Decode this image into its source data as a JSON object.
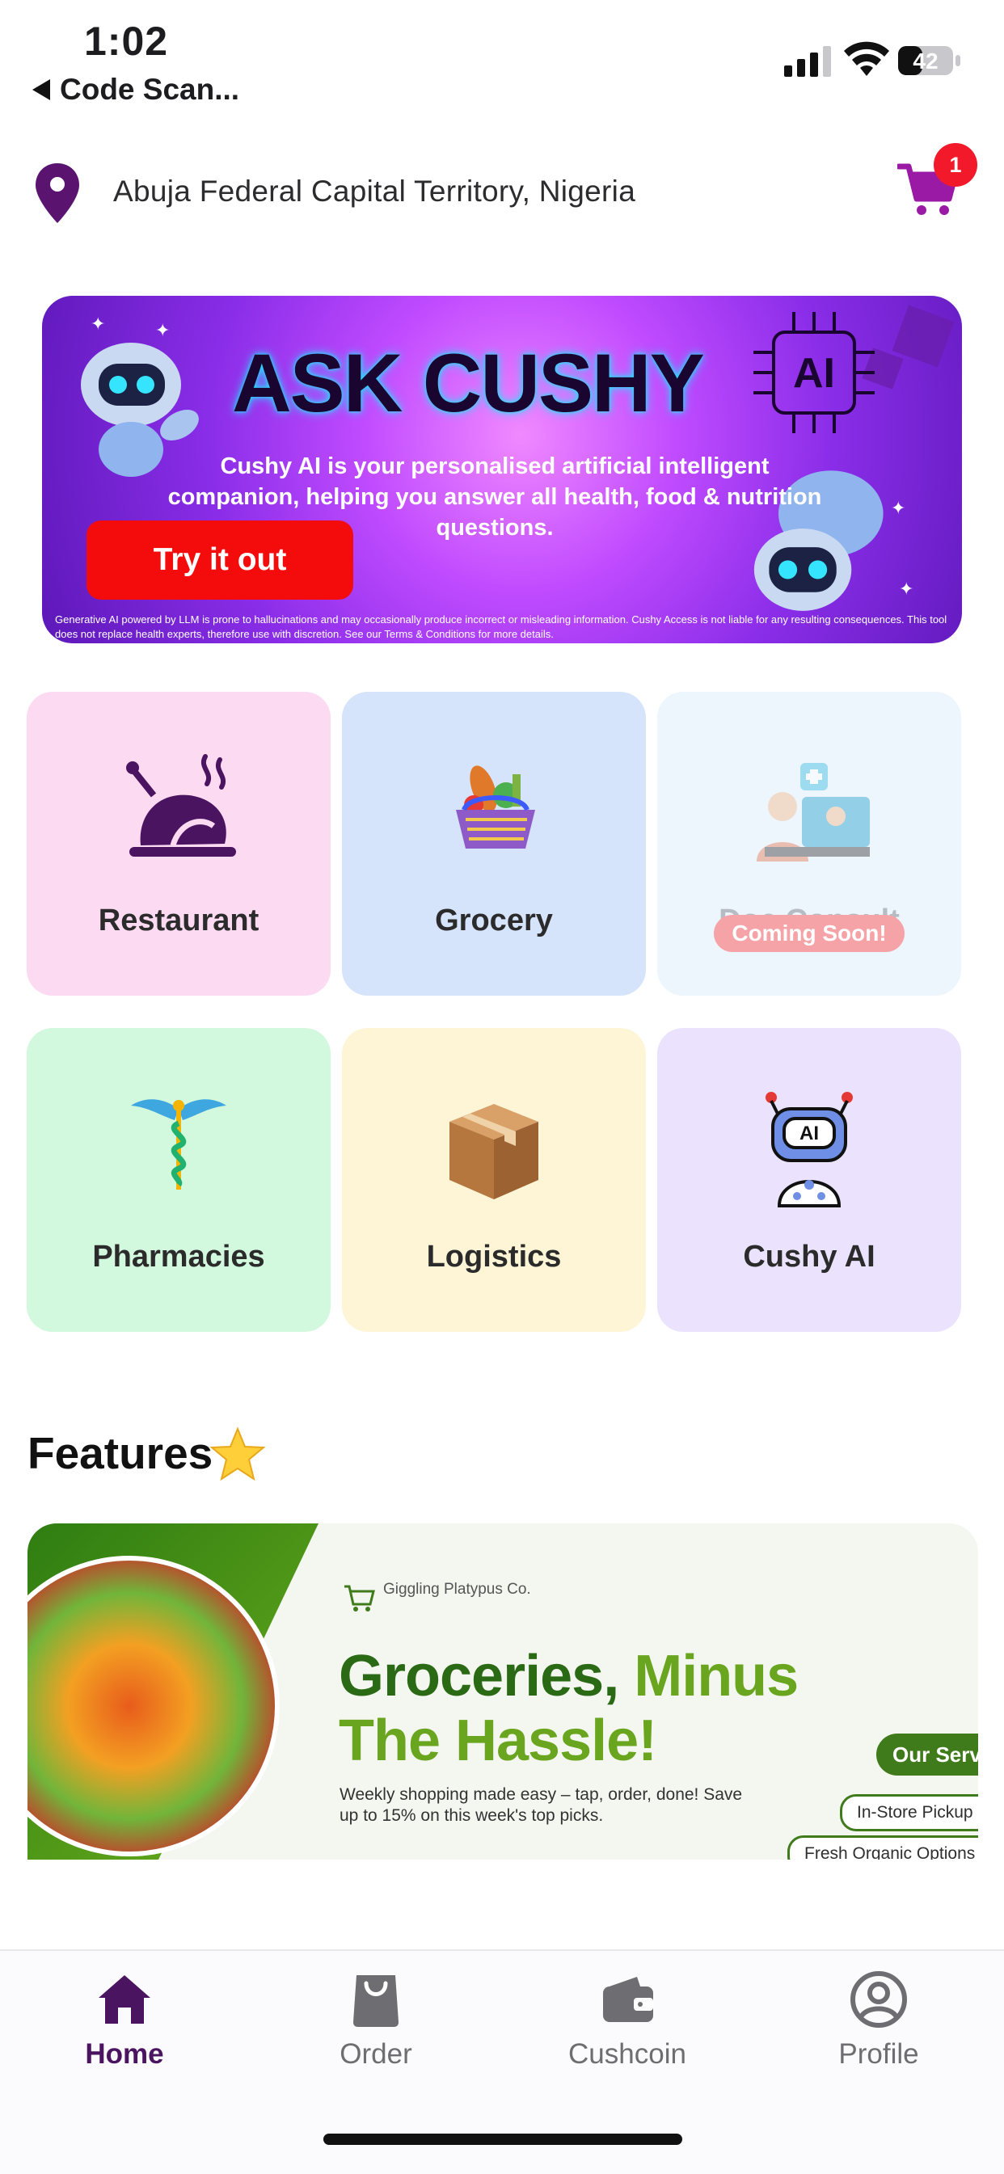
{
  "status_bar": {
    "time": "1:02",
    "back_label": "Code Scan...",
    "battery": "42"
  },
  "header": {
    "location": "Abuja Federal Capital Territory, Nigeria",
    "cart_count": "1"
  },
  "banner": {
    "title": "ASK CUSHY",
    "chip_label": "AI",
    "body": "Cushy AI is your personalised artificial intelligent companion, helping you answer all health, food & nutrition questions.",
    "cta": "Try it out",
    "disclaimer": "Generative AI powered by LLM is prone to hallucinations and may occasionally produce incorrect or misleading information. Cushy Access is not liable for any resulting consequences. This tool does not replace health experts, therefore use with discretion. See our Terms & Conditions for more details."
  },
  "services": [
    {
      "label": "Restaurant",
      "bg": "#fcdaf1"
    },
    {
      "label": "Grocery",
      "bg": "#d6e4fb"
    },
    {
      "label": "Doc Consult",
      "bg": "#edf5fd",
      "badge": "Coming Soon!"
    },
    {
      "label": "Pharmacies",
      "bg": "#d2f8de"
    },
    {
      "label": "Logistics",
      "bg": "#fdf5d6"
    },
    {
      "label": "Cushy AI",
      "bg": "#ebe3fd"
    }
  ],
  "features": {
    "title": "Features",
    "promo": {
      "brand": "Giggling Platypus Co.",
      "headline_1a": "Groceries,",
      "headline_1b": "Minus",
      "headline_2": "The Hassle!",
      "subtext": "Weekly shopping made easy – tap, order, done! Save up to 15% on this week's top picks.",
      "pill_1": "Our Serv",
      "pill_2": "In-Store Pickup",
      "pill_3": "Fresh Organic Options"
    }
  },
  "tabbar": {
    "items": [
      {
        "label": "Home",
        "icon": "home-icon"
      },
      {
        "label": "Order",
        "icon": "bag-icon"
      },
      {
        "label": "Cushcoin",
        "icon": "wallet-icon"
      },
      {
        "label": "Profile",
        "icon": "profile-icon"
      }
    ]
  },
  "colors": {
    "brand": "#4b1461",
    "accent_red": "#f40c0c",
    "badge_red": "#f2192b"
  }
}
